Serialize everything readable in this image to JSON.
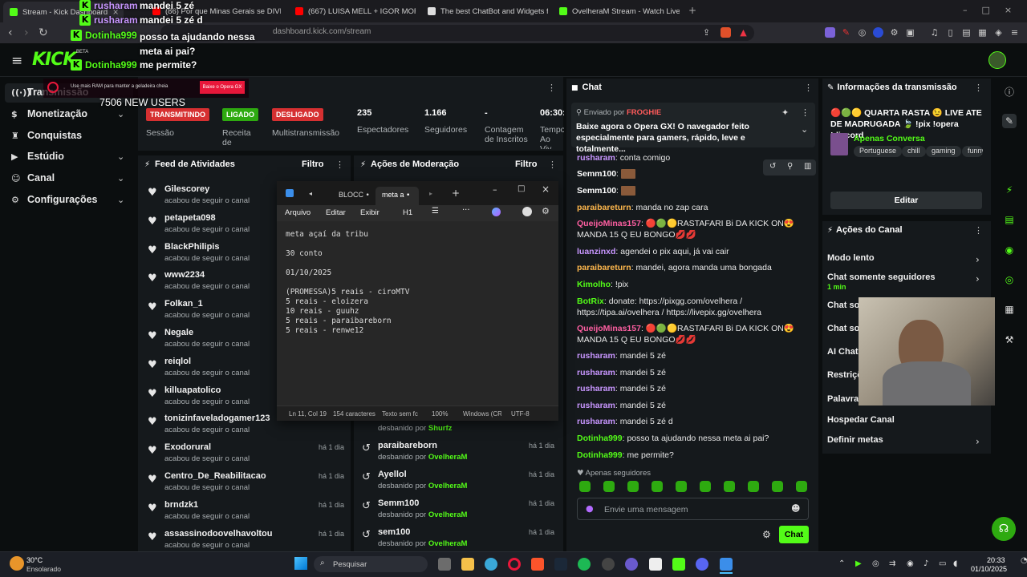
{
  "browser": {
    "tabs": [
      {
        "label": "Stream - Kick Dashboard",
        "color": "#53fc18"
      },
      {
        "label": "(86) Por que Minas Gerais se DIVIDI",
        "color": "#ff0000"
      },
      {
        "label": "(667) LUISA MELL + IGOR MORAIS V",
        "color": "#ff0000"
      },
      {
        "label": "The best ChatBot and Widgets for Ki",
        "color": "#dddddd"
      },
      {
        "label": "OvelheraM Stream - Watch Live on K",
        "color": "#53fc18"
      }
    ],
    "url": "dashboard.kick.com/stream"
  },
  "header": {
    "logo": "KICK",
    "beta": "BETA"
  },
  "sidebar": {
    "items": [
      {
        "label": "Transmissão",
        "icon": "broadcast-icon"
      },
      {
        "label": "Monetização",
        "icon": "dollar-icon"
      },
      {
        "label": "Conquistas",
        "icon": "trophy-icon"
      },
      {
        "label": "Estúdio",
        "icon": "video-icon"
      },
      {
        "label": "Canal",
        "icon": "person-icon"
      },
      {
        "label": "Configurações",
        "icon": "gear-icon"
      }
    ]
  },
  "overlay": {
    "chat": [
      {
        "user": "rusharam",
        "msg": "mandei 5 zé"
      },
      {
        "user": "rusharam",
        "msg": "mandei 5 zé d"
      },
      {
        "user": "Dotinha999",
        "msg": "posso ta ajudando nessa meta ai pai?"
      },
      {
        "user": "Dotinha999",
        "msg": "me permite?"
      }
    ],
    "new_users": "7506 NEW USERS",
    "opera_ad": "Use mais RAM para manter a geladeira cheia",
    "opera_btn": "Baixe o Opera GX"
  },
  "stats": {
    "sessao": {
      "badge": "TRANSMITINDO",
      "label": "Sessão"
    },
    "receita": {
      "badge": "LIGADO",
      "label": "Receita de"
    },
    "multi": {
      "badge": "DESLIGADO",
      "label": "Multistransmissão"
    },
    "espectadores": {
      "value": "235",
      "label": "Espectadores"
    },
    "seguidores": {
      "value": "1.166",
      "label": "Seguidores"
    },
    "inscritos": {
      "value": "-",
      "label": "Contagem de Inscritos"
    },
    "tempo": {
      "value": "06:30:",
      "label": "Tempo Ao Viv"
    }
  },
  "feed": {
    "title": "Feed de Atividades",
    "filter": "Filtro",
    "items": [
      {
        "name": "Gilescorey",
        "sub": "acabou de seguir o canal",
        "time": ""
      },
      {
        "name": "petapeta098",
        "sub": "acabou de seguir o canal",
        "time": ""
      },
      {
        "name": "BlackPhilipis",
        "sub": "acabou de seguir o canal",
        "time": ""
      },
      {
        "name": "www2234",
        "sub": "acabou de seguir o canal",
        "time": ""
      },
      {
        "name": "Folkan_1",
        "sub": "acabou de seguir o canal",
        "time": ""
      },
      {
        "name": "Negale",
        "sub": "acabou de seguir o canal",
        "time": ""
      },
      {
        "name": "reiqlol",
        "sub": "acabou de seguir o canal",
        "time": ""
      },
      {
        "name": "killuapatolico",
        "sub": "acabou de seguir o canal",
        "time": ""
      },
      {
        "name": "tonizinfaveladogamer123",
        "sub": "acabou de seguir o canal",
        "time": ""
      },
      {
        "name": "Exodorural",
        "sub": "acabou de seguir o canal",
        "time": "há 1 dia"
      },
      {
        "name": "Centro_De_Reabilitacao",
        "sub": "acabou de seguir o canal",
        "time": "há 1 dia"
      },
      {
        "name": "brndzk1",
        "sub": "acabou de seguir o canal",
        "time": "há 1 dia"
      },
      {
        "name": "assassinodoovelhavoltou",
        "sub": "acabou de seguir o canal",
        "time": "há 1 dia"
      }
    ]
  },
  "mod": {
    "title": "Ações de Moderação",
    "filter": "Filtro",
    "partial": {
      "sub": "desbanido por",
      "by": "Shurfz"
    },
    "items": [
      {
        "name": "paraibareborn",
        "sub": "desbanido por",
        "by": "OvelheraM",
        "time": "há 1 dia"
      },
      {
        "name": "Ayellol",
        "sub": "desbanido por",
        "by": "OvelheraM",
        "time": "há 1 dia"
      },
      {
        "name": "Semm100",
        "sub": "desbanido por",
        "by": "OvelheraM",
        "time": "há 1 dia"
      },
      {
        "name": "sem100",
        "sub": "desbanido por",
        "by": "OvelheraM",
        "time": "há 1 dia"
      }
    ]
  },
  "notepad": {
    "tabs": [
      "BLOCC",
      "meta a"
    ],
    "menu": [
      "Arquivo",
      "Editar",
      "Exibir",
      "H1"
    ],
    "lines": [
      "meta açaí da tribu",
      "",
      "30 conto",
      "",
      "01/10/2025",
      "",
      "(PROMESSA)5 reais - ciroMTV",
      "5 reais - eloizera",
      "10 reais - guuhz",
      "5 reais - paraibareborn",
      "5 reais - renwe12"
    ],
    "status": [
      "Ln 11, Col 19",
      "154 caracteres",
      "Texto sem fc",
      "100%",
      "Windows (CR",
      "UTF-8"
    ]
  },
  "chat": {
    "title": "Chat",
    "pinned": {
      "by_label": "Enviado por",
      "by": "FROGHIE",
      "text": "Baixe agora o Opera GX! O navegador feito especialmente para gamers, rápido, leve e totalmente..."
    },
    "messages": [
      {
        "user": "rusharam",
        "color": "#c896ff",
        "text": "conta comigo"
      },
      {
        "user": "Semm100",
        "color": "#ffffff",
        "text": ""
      },
      {
        "user": "Semm100",
        "color": "#ffffff",
        "text": ""
      },
      {
        "user": "paraibareturn",
        "color": "#ffb84d",
        "text": "manda no zap cara"
      },
      {
        "user": "QueijoMinas157",
        "color": "#ff5fa2",
        "text": "🔴🟢🟡RASTAFARI Bi DA KICK ON😍 MANDA 15 Q EU BONGO💋💋"
      },
      {
        "user": "luanzinxd",
        "color": "#c896ff",
        "text": "agendei o pix aqui, já vai cair"
      },
      {
        "user": "paraibareturn",
        "color": "#ffb84d",
        "text": "mandei, agora manda uma bongada"
      },
      {
        "user": "Kimolho",
        "color": "#53fc18",
        "text": "!pix"
      },
      {
        "user": "BotRix",
        "color": "#53fc18",
        "text": "donate: https://pixgg.com/ovelhera / https://tipa.ai/ovelhera / https://livepix.gg/ovelhera"
      },
      {
        "user": "QueijoMinas157",
        "color": "#ff5fa2",
        "text": "🔴🟢🟡RASTAFARI Bi DA KICK ON😍 MANDA 15 Q EU BONGO💋💋"
      },
      {
        "user": "rusharam",
        "color": "#c896ff",
        "text": "mandei 5 zé"
      },
      {
        "user": "rusharam",
        "color": "#c896ff",
        "text": "mandei 5 zé"
      },
      {
        "user": "rusharam",
        "color": "#c896ff",
        "text": "mandei 5 zé"
      },
      {
        "user": "rusharam",
        "color": "#c896ff",
        "text": "mandei 5 zé"
      },
      {
        "user": "rusharam",
        "color": "#c896ff",
        "text": "mandei 5 zé d"
      },
      {
        "user": "Dotinha999",
        "color": "#53fc18",
        "text": "posso ta ajudando nessa meta ai pai?"
      },
      {
        "user": "Dotinha999",
        "color": "#53fc18",
        "text": "me permite?"
      }
    ],
    "followers_only": "Apenas seguidores",
    "placeholder": "Envie uma mensagem",
    "send": "Chat"
  },
  "info": {
    "title": "Informações da transmissão",
    "stream_title": "🔴🟢🟡 QUARTA RASTA 😉 LIVE ATE DE MADRUGADA 🍃 !pix !opera !discord",
    "category": "Apenas Conversa",
    "tags": [
      "Portuguese",
      "chill",
      "gaming",
      "funny"
    ],
    "edit": "Editar"
  },
  "channel": {
    "title": "Ações do Canal",
    "items": [
      {
        "label": "Modo lento",
        "sub": ""
      },
      {
        "label": "Chat somente seguidores",
        "sub": "1 min"
      },
      {
        "label": "Chat som",
        "sub": ""
      },
      {
        "label": "Chat som",
        "sub": ""
      },
      {
        "label": "AI Chat M",
        "sub": ""
      },
      {
        "label": "Restriçõ",
        "sub": ""
      },
      {
        "label": "Palavras",
        "sub": ""
      },
      {
        "label": "Hospedar Canal",
        "sub": ""
      },
      {
        "label": "Definir metas",
        "sub": ""
      }
    ]
  },
  "taskbar": {
    "weather": {
      "temp": "30°C",
      "desc": "Ensolarado"
    },
    "search": "Pesquisar",
    "time": "20:33",
    "date": "01/10/2025"
  },
  "colors": {
    "accent": "#53fc18",
    "panel": "#15191c",
    "bg": "#0b0e0f"
  }
}
